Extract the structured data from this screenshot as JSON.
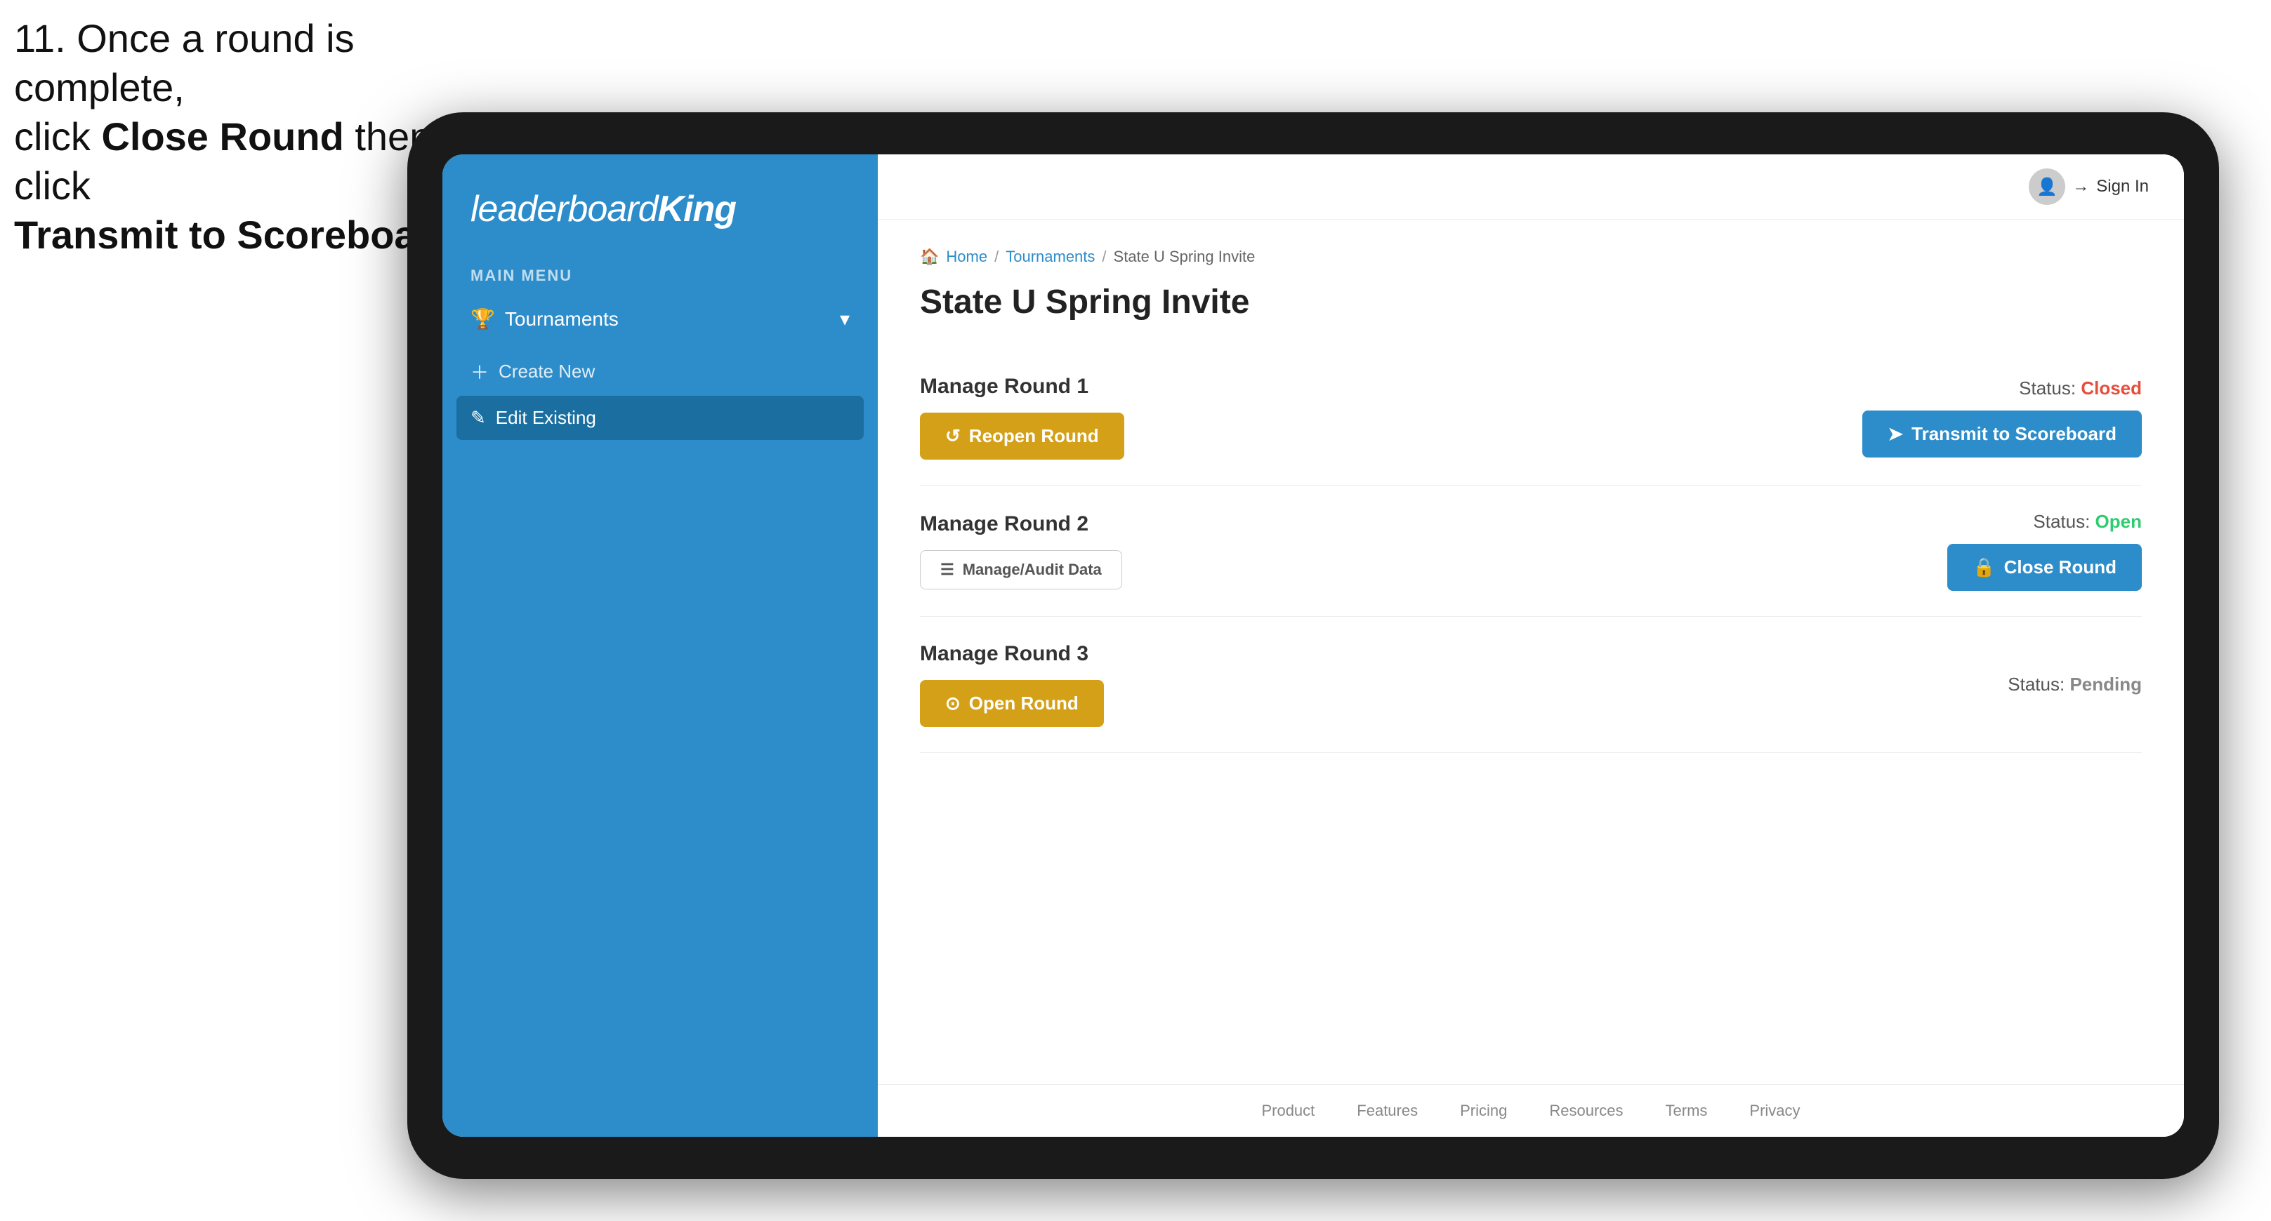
{
  "instruction": {
    "line1": "11. Once a round is complete,",
    "line2": "click ",
    "bold1": "Close Round",
    "line3": " then click",
    "bold2": "Transmit to Scoreboard."
  },
  "logo": {
    "leaderboard": "leaderboard",
    "king": "King"
  },
  "sidebar": {
    "main_menu_label": "MAIN MENU",
    "tournaments_label": "Tournaments",
    "create_new_label": "Create New",
    "edit_existing_label": "Edit Existing"
  },
  "header": {
    "sign_in_label": "Sign In"
  },
  "breadcrumb": {
    "home": "Home",
    "tournaments": "Tournaments",
    "current": "State U Spring Invite"
  },
  "page": {
    "title": "State U Spring Invite"
  },
  "rounds": [
    {
      "title": "Manage Round 1",
      "status_label": "Status:",
      "status_value": "Closed",
      "status_type": "closed",
      "buttons": [
        {
          "label": "Reopen Round",
          "type": "gold",
          "icon": "↺"
        }
      ],
      "right_buttons": [
        {
          "label": "Transmit to Scoreboard",
          "type": "blue",
          "icon": "➤"
        }
      ]
    },
    {
      "title": "Manage Round 2",
      "status_label": "Status:",
      "status_value": "Open",
      "status_type": "open",
      "buttons": [
        {
          "label": "Manage/Audit Data",
          "type": "audit",
          "icon": "☰"
        }
      ],
      "right_buttons": [
        {
          "label": "Close Round",
          "type": "blue",
          "icon": "🔒"
        }
      ]
    },
    {
      "title": "Manage Round 3",
      "status_label": "Status:",
      "status_value": "Pending",
      "status_type": "pending",
      "buttons": [
        {
          "label": "Open Round",
          "type": "gold",
          "icon": "⊙"
        }
      ],
      "right_buttons": []
    }
  ],
  "footer": {
    "links": [
      "Product",
      "Features",
      "Pricing",
      "Resources",
      "Terms",
      "Privacy"
    ]
  }
}
